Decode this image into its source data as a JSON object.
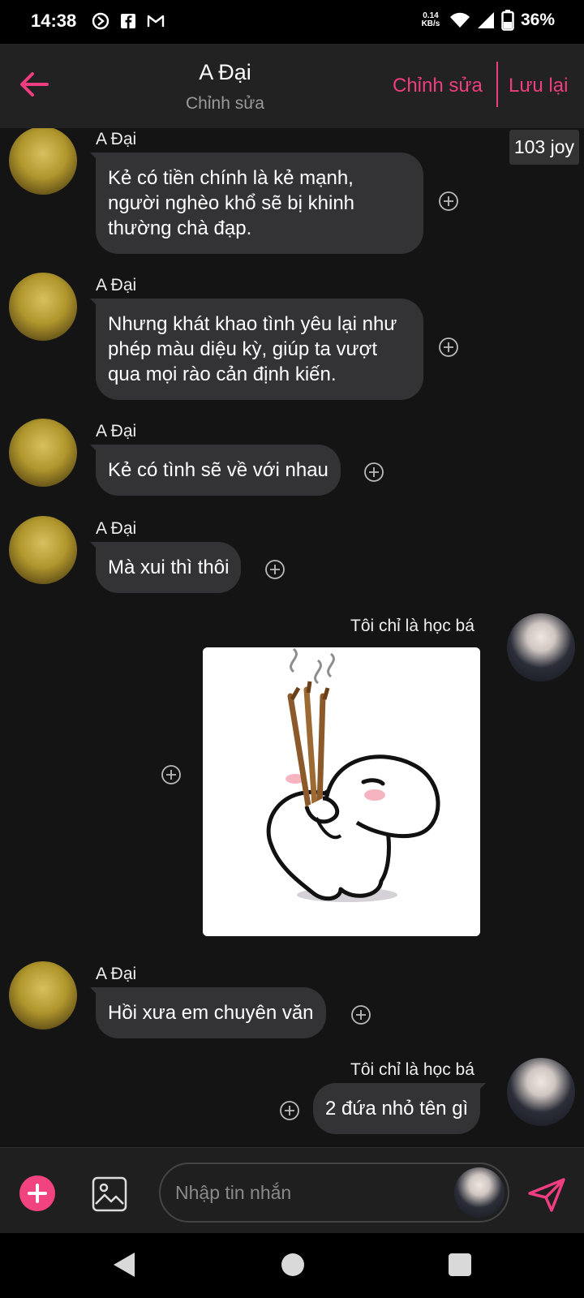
{
  "status_bar": {
    "time": "14:38",
    "speed_top": "0.14",
    "speed_bottom": "KB/s",
    "battery": "36%",
    "icons": [
      "vpn-icon",
      "facebook-icon",
      "gmail-icon",
      "wifi-icon",
      "signal-icon",
      "battery-icon"
    ]
  },
  "header": {
    "title": "A Đại",
    "subtitle": "Chỉnh sửa",
    "edit_label": "Chỉnh sửa",
    "save_label": "Lưu lại",
    "accent_color": "#ee3d80"
  },
  "joy_badge": "103 joy",
  "messages": [
    {
      "sender": "A Đại",
      "side": "left",
      "lines": [
        "Kẻ có tiền chính là kẻ mạnh,",
        "người nghèo khổ sẽ bị khinh",
        "thường chà đạp."
      ]
    },
    {
      "sender": "A Đại",
      "side": "left",
      "lines": [
        "Nhưng khát khao tình yêu lại như",
        "phép màu diệu kỳ, giúp ta vượt",
        "qua mọi rào cản định kiến."
      ]
    },
    {
      "sender": "A Đại",
      "side": "left",
      "lines": [
        "Kẻ có tình sẽ về với nhau"
      ]
    },
    {
      "sender": "A Đại",
      "side": "left",
      "lines": [
        "Mà xui thì thôi"
      ]
    },
    {
      "sender": "Tôi chỉ là học bá",
      "side": "right",
      "type": "sticker"
    },
    {
      "sender": "A Đại",
      "side": "left",
      "lines": [
        "Hồi xưa em chuyên văn"
      ]
    },
    {
      "sender": "Tôi chỉ là học bá",
      "side": "right",
      "lines": [
        "2 đứa nhỏ tên gì"
      ]
    }
  ],
  "composer": {
    "placeholder": "Nhập tin nhắn"
  }
}
